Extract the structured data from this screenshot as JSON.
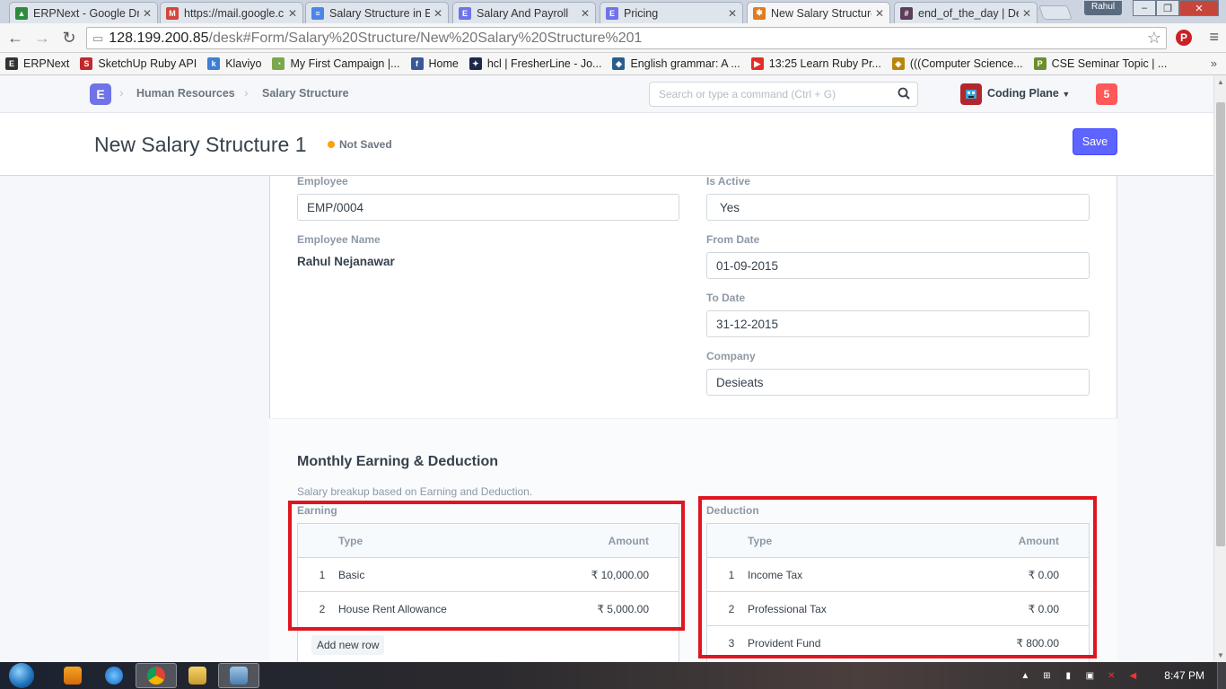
{
  "browser": {
    "tabs": [
      {
        "title": "ERPNext - Google Dr",
        "color": "#2c8c3c",
        "glyph": "▲"
      },
      {
        "title": "https://mail.google.c",
        "color": "#d44638",
        "glyph": "M"
      },
      {
        "title": "Salary Structure in ER",
        "color": "#4a86e8",
        "glyph": "≡"
      },
      {
        "title": "Salary And Payroll",
        "color": "#6f73e8",
        "glyph": "E"
      },
      {
        "title": "Pricing",
        "color": "#6f73e8",
        "glyph": "E"
      },
      {
        "title": "New Salary Structure",
        "color": "#e07b1f",
        "glyph": "✱"
      },
      {
        "title": "end_of_the_day | Des",
        "color": "#5c3d5c",
        "glyph": "#"
      }
    ],
    "user_badge": "Rahul",
    "url_host": "128.199.200.85",
    "url_path": "/desk#Form/Salary%20Structure/New%20Salary%20Structure%201",
    "bookmarks": [
      {
        "label": "ERPNext",
        "color": "#333333",
        "glyph": "E"
      },
      {
        "label": "SketchUp Ruby API",
        "color": "#c0282d",
        "glyph": "S"
      },
      {
        "label": "Klaviyo",
        "color": "#3d7fd6",
        "glyph": "k"
      },
      {
        "label": "My First Campaign |...",
        "color": "#7aa84e",
        "glyph": "◔"
      },
      {
        "label": "Home",
        "color": "#3b5998",
        "glyph": "f"
      },
      {
        "label": "hcl | FresherLine - Jo...",
        "color": "#1b2a4a",
        "glyph": "✦"
      },
      {
        "label": "English grammar: A ...",
        "color": "#2a5d8c",
        "glyph": "◆"
      },
      {
        "label": "13:25 Learn Ruby Pr...",
        "color": "#e52d27",
        "glyph": "▶"
      },
      {
        "label": "(((Computer Science...",
        "color": "#b8860b",
        "glyph": "◈"
      },
      {
        "label": "CSE Seminar Topic | ...",
        "color": "#6a8f2e",
        "glyph": "P"
      }
    ],
    "bookmarks_more": "»"
  },
  "navbar": {
    "app_logo": "E",
    "breadcrumbs": [
      "Human Resources",
      "Salary Structure"
    ],
    "search_placeholder": "Search or type a command (Ctrl + G)",
    "user_name": "Coding Plane",
    "notifications": "5"
  },
  "page": {
    "title": "New Salary Structure 1",
    "status": "Not Saved",
    "save_label": "Save"
  },
  "form": {
    "employee_label": "Employee",
    "employee_value": "EMP/0004",
    "employee_name_label": "Employee Name",
    "employee_name_value": "Rahul Nejanawar",
    "is_active_label": "Is Active",
    "is_active_value": "Yes",
    "from_date_label": "From Date",
    "from_date_value": "01-09-2015",
    "to_date_label": "To Date",
    "to_date_value": "31-12-2015",
    "company_label": "Company",
    "company_value": "Desieats"
  },
  "section": {
    "title": "Monthly Earning & Deduction",
    "description": "Salary breakup based on Earning and Deduction."
  },
  "earning": {
    "label": "Earning",
    "columns": {
      "type": "Type",
      "amount": "Amount"
    },
    "rows": [
      {
        "idx": "1",
        "type": "Basic",
        "amount": "₹ 10,000.00"
      },
      {
        "idx": "2",
        "type": "House Rent Allowance",
        "amount": "₹ 5,000.00"
      }
    ],
    "add_row": "Add new row"
  },
  "deduction": {
    "label": "Deduction",
    "columns": {
      "type": "Type",
      "amount": "Amount"
    },
    "rows": [
      {
        "idx": "1",
        "type": "Income Tax",
        "amount": "₹ 0.00"
      },
      {
        "idx": "2",
        "type": "Professional Tax",
        "amount": "₹ 0.00"
      },
      {
        "idx": "3",
        "type": "Provident Fund",
        "amount": "₹ 800.00"
      }
    ]
  },
  "taskbar": {
    "clock": "8:47 PM"
  }
}
